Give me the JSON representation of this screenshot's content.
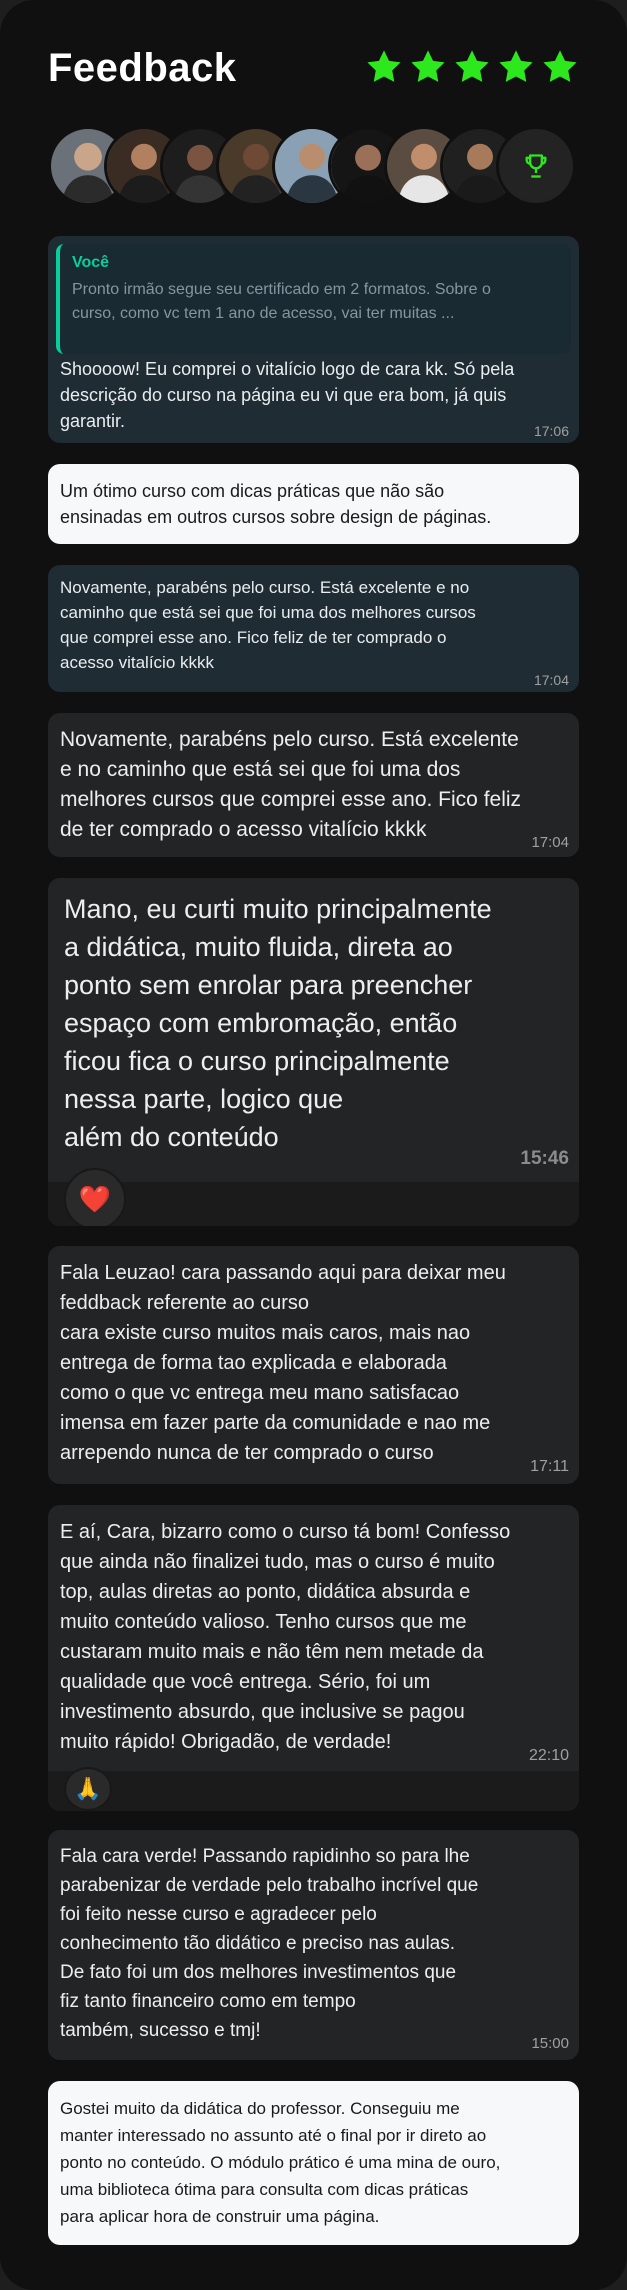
{
  "header": {
    "title": "Feedback",
    "rating": 5,
    "star_color": "#2ee81e"
  },
  "avatars": [
    {
      "name": "avatar-1"
    },
    {
      "name": "avatar-2"
    },
    {
      "name": "avatar-3"
    },
    {
      "name": "avatar-4"
    },
    {
      "name": "avatar-5"
    },
    {
      "name": "avatar-6"
    },
    {
      "name": "avatar-7"
    },
    {
      "name": "avatar-8"
    }
  ],
  "badge_icon": "trophy-icon",
  "messages": [
    {
      "quote_author": "Você",
      "quote_text": "Pronto irmão segue seu certificado em 2 formatos. Sobre o\ncurso, como vc tem 1 ano de acesso, vai ter muitas ...",
      "text": "Shoooow! Eu comprei o vitalício logo de cara kk. Só pela\ndescrição do curso na página eu vi que era bom, já quis\ngarantir.",
      "time": "17:06"
    },
    {
      "text": "Um ótimo curso com dicas práticas que não são\nensinadas em outros cursos sobre design de páginas."
    },
    {
      "text": "Novamente, parabéns pelo curso. Está excelente e no\ncaminho que está sei que foi uma dos melhores cursos\nque comprei esse ano. Fico feliz de ter comprado o\nacesso vitalício kkkk",
      "time": "17:04"
    },
    {
      "text": "Novamente, parabéns pelo curso. Está excelente\ne no caminho que está sei que foi uma dos\nmelhores cursos que comprei esse ano. Fico feliz\nde ter comprado o acesso vitalício kkkk",
      "time": "17:04"
    },
    {
      "text": "Mano, eu curti muito principalmente\na didática, muito fluida, direta ao\nponto sem enrolar para preencher\nespaço com embromação, então\nficou fica o curso principalmente\nnessa parte, logico que\nalém do conteúdo",
      "time": "15:46",
      "reaction": "❤️"
    },
    {
      "text": "Fala Leuzao! cara passando aqui para deixar meu\nfeddback referente ao curso\ncara existe curso muitos mais caros, mais nao\nentrega de forma tao explicada e elaborada\ncomo o que vc entrega meu mano satisfacao\nimensa em fazer parte da comunidade e nao me\narrependo nunca de ter comprado o curso",
      "time": "17:11"
    },
    {
      "text": "E aí, Cara, bizarro como o curso tá bom! Confesso\nque ainda não finalizei tudo, mas o curso é muito\ntop, aulas diretas ao ponto, didática absurda e\nmuito conteúdo valioso. Tenho cursos que me\ncustaram muito mais e não têm nem metade da\nqualidade que você entrega. Sério, foi um\ninvestimento absurdo, que inclusive se pagou\nmuito rápido! Obrigadão, de verdade!",
      "time": "22:10",
      "reaction": "🙏"
    },
    {
      "text": "Fala cara verde! Passando rapidinho so para lhe\nparabenizar de verdade pelo trabalho incrível que\nfoi feito nesse curso e agradecer pelo\nconhecimento tão didático e preciso nas aulas.\nDe fato foi um dos melhores investimentos que\nfiz tanto financeiro como em tempo\ntambém, sucesso e tmj!",
      "time": "15:00"
    },
    {
      "text": "Gostei muito da didática do professor. Conseguiu me\nmanter interessado no assunto até o final por ir direto ao\nponto no conteúdo. O módulo prático é uma mina de ouro,\numa biblioteca ótima para consulta com dicas práticas\npara aplicar hora de construir uma página."
    }
  ]
}
